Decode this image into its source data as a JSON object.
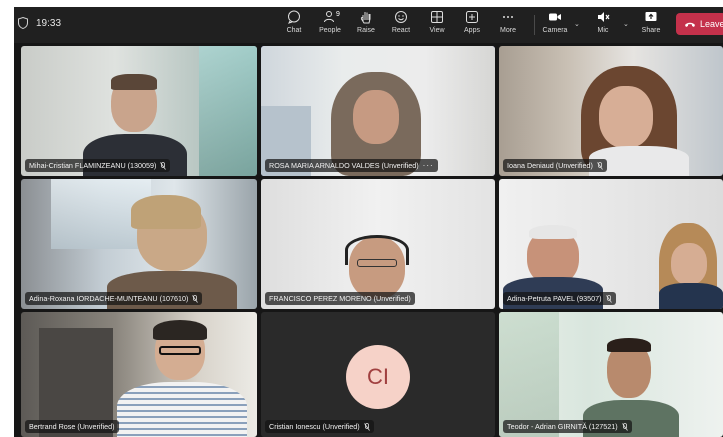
{
  "toolbar": {
    "time": "19:33",
    "people_count": "9",
    "items": [
      {
        "label": "Chat",
        "icon": "chat-icon"
      },
      {
        "label": "People",
        "icon": "people-icon"
      },
      {
        "label": "Raise",
        "icon": "raise-hand-icon"
      },
      {
        "label": "React",
        "icon": "react-icon"
      },
      {
        "label": "View",
        "icon": "view-icon"
      },
      {
        "label": "Apps",
        "icon": "apps-icon"
      },
      {
        "label": "More",
        "icon": "more-icon"
      }
    ],
    "camera_label": "Camera",
    "mic_label": "Mic",
    "share_label": "Share",
    "leave_label": "Leave",
    "leave_color": "#c4314b"
  },
  "participants": [
    {
      "name": "Mihai-Cristian FLAMINZEANU (130059)"
    },
    {
      "name": "ROSA MARIA ARNALDO VALDES (Unverified)"
    },
    {
      "name": "Ioana Deniaud (Unverified)"
    },
    {
      "name": "Adina-Roxana IORDACHE-MUNTEANU (107610)"
    },
    {
      "name": "FRANCISCO PEREZ MORENO (Unverified)"
    },
    {
      "name": "Adina-Petruta PAVEL (93507)"
    },
    {
      "name": "Bertrand Rose (Unverified)"
    },
    {
      "name": "Cristian Ionescu (Unverified)",
      "initials": "CI"
    },
    {
      "name": "Teodor - Adrian GIRNITĂ (127521)"
    }
  ]
}
